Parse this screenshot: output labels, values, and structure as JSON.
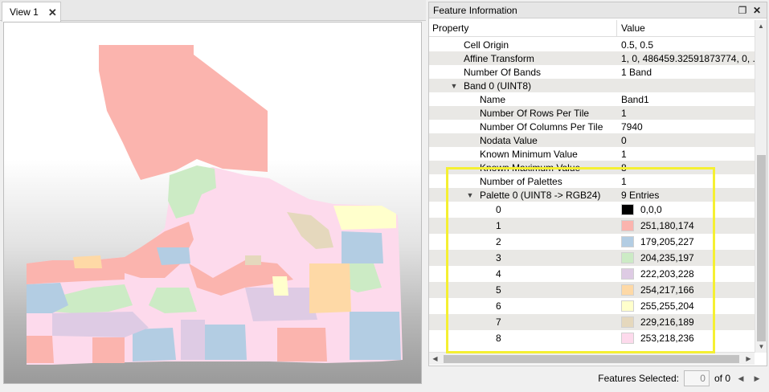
{
  "view": {
    "tab_label": "View 1",
    "tab_close": "✕"
  },
  "panel": {
    "title": "Feature Information",
    "restore_icon": "❐",
    "close_icon": "✕",
    "columns": {
      "property": "Property",
      "value": "Value"
    },
    "rows": [
      {
        "label": "Cell Origin",
        "value": "0.5, 0.5"
      },
      {
        "label": "Affine Transform",
        "value": "1, 0, 486459.32591873774, 0, ..."
      },
      {
        "label": "Number Of Bands",
        "value": "1 Band"
      },
      {
        "label": "Band 0 (UINT8)",
        "value": ""
      },
      {
        "label": "Name",
        "value": "Band1"
      },
      {
        "label": "Number Of Rows Per Tile",
        "value": "1"
      },
      {
        "label": "Number Of Columns Per Tile",
        "value": "7940"
      },
      {
        "label": "Nodata Value",
        "value": "0"
      },
      {
        "label": "Known Minimum Value",
        "value": "1"
      },
      {
        "label": "Known Maximum Value",
        "value": "8"
      },
      {
        "label": "Number of Palettes",
        "value": "1"
      },
      {
        "label": "Palette 0 (UINT8 -> RGB24)",
        "value": "9 Entries"
      }
    ],
    "palette": [
      {
        "index": "0",
        "rgb": "0,0,0",
        "color": "#000000"
      },
      {
        "index": "1",
        "rgb": "251,180,174",
        "color": "#fbb4ae"
      },
      {
        "index": "2",
        "rgb": "179,205,227",
        "color": "#b3cde3"
      },
      {
        "index": "3",
        "rgb": "204,235,197",
        "color": "#ccebc5"
      },
      {
        "index": "4",
        "rgb": "222,203,228",
        "color": "#decbe4"
      },
      {
        "index": "5",
        "rgb": "254,217,166",
        "color": "#fed9a6"
      },
      {
        "index": "6",
        "rgb": "255,255,204",
        "color": "#ffffcc"
      },
      {
        "index": "7",
        "rgb": "229,216,189",
        "color": "#e5d8bd"
      },
      {
        "index": "8",
        "rgb": "253,218,236",
        "color": "#fddaec"
      }
    ]
  },
  "status": {
    "features_selected_label": "Features Selected:",
    "selected_count": "0",
    "of_total": "of 0"
  },
  "colors": {
    "highlight": "#f5f032"
  }
}
